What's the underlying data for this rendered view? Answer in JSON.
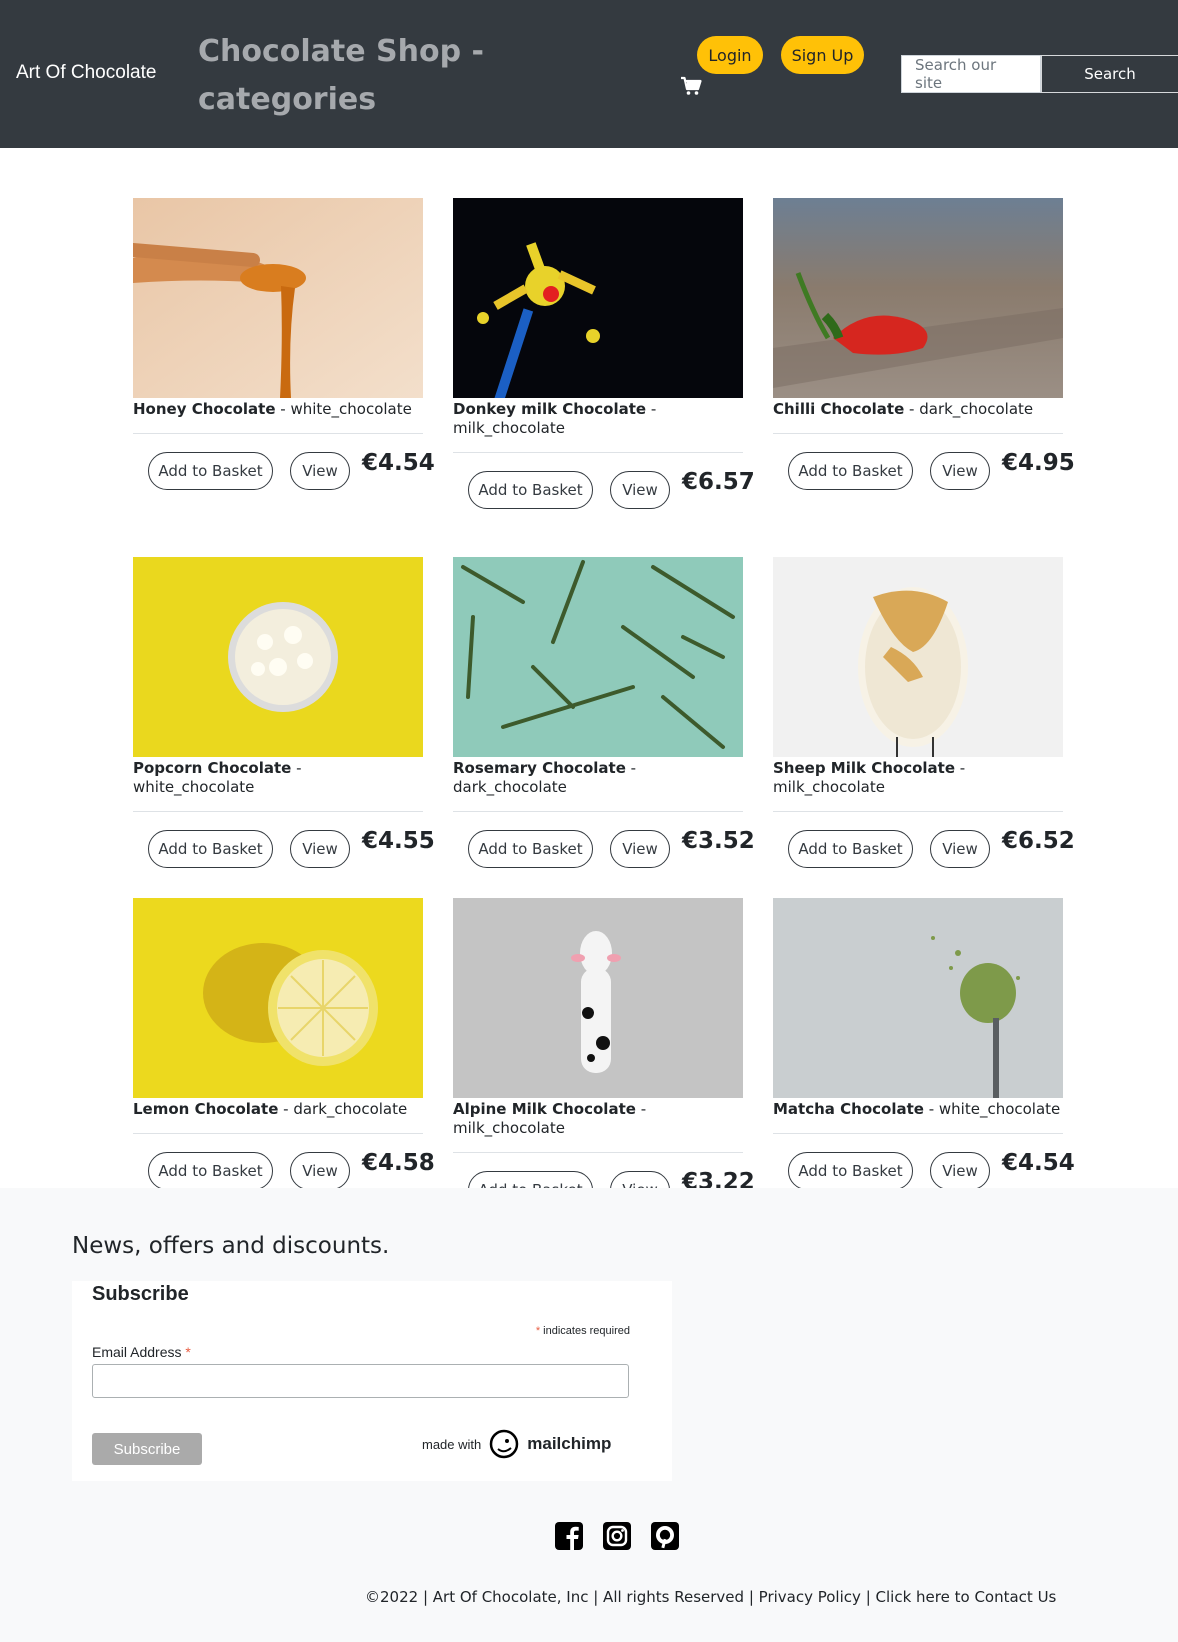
{
  "header": {
    "brand": "Art Of Chocolate",
    "title": "Chocolate Shop - categories",
    "login_label": "Login",
    "signup_label": "Sign Up",
    "search_placeholder": "Search our site",
    "search_label": "Search"
  },
  "products": [
    {
      "name": "Honey Chocolate",
      "category": "white_chocolate",
      "price": "€4.54",
      "add_label": "Add to Basket",
      "view_label": "View"
    },
    {
      "name": "Donkey milk Chocolate",
      "category": "milk_chocolate",
      "price": "€6.57",
      "add_label": "Add to Basket",
      "view_label": "View"
    },
    {
      "name": "Chilli Chocolate",
      "category": "dark_chocolate",
      "price": "€4.95",
      "add_label": "Add to Basket",
      "view_label": "View"
    },
    {
      "name": "Popcorn Chocolate",
      "category": "white_chocolate",
      "price": "€4.55",
      "add_label": "Add to Basket",
      "view_label": "View"
    },
    {
      "name": "Rosemary Chocolate",
      "category": "dark_chocolate",
      "price": "€3.52",
      "add_label": "Add to Basket",
      "view_label": "View"
    },
    {
      "name": "Sheep Milk Chocolate",
      "category": "milk_chocolate",
      "price": "€6.52",
      "add_label": "Add to Basket",
      "view_label": "View"
    },
    {
      "name": "Lemon Chocolate",
      "category": "dark_chocolate",
      "price": "€4.58",
      "add_label": "Add to Basket",
      "view_label": "View"
    },
    {
      "name": "Alpine Milk Chocolate",
      "category": "milk_chocolate",
      "price": "€3.22",
      "add_label": "Add to Basket",
      "view_label": "View"
    },
    {
      "name": "Matcha Chocolate",
      "category": "white_chocolate",
      "price": "€4.54",
      "add_label": "Add to Basket",
      "view_label": "View"
    }
  ],
  "newsletter": {
    "heading": "News, offers and discounts.",
    "subscribe_title": "Subscribe",
    "required_note": "indicates required",
    "required_star": "*",
    "email_label": "Email Address",
    "subscribe_button": "Subscribe",
    "made_with": "made with",
    "mailchimp": "mailchimp"
  },
  "footer": {
    "copyright": "©2022 | Art Of Chocolate, Inc | All rights Reserved |",
    "privacy": "Privacy Policy",
    "separator": "|",
    "contact": "Click here to Contact Us"
  },
  "colors": {
    "header_bg": "#343a40",
    "accent_yellow": "#ffc107",
    "footer_bg": "#f8f9fa"
  },
  "icons": [
    "cart-icon",
    "facebook-icon",
    "instagram-icon",
    "pinterest-icon",
    "mailchimp-logo"
  ]
}
